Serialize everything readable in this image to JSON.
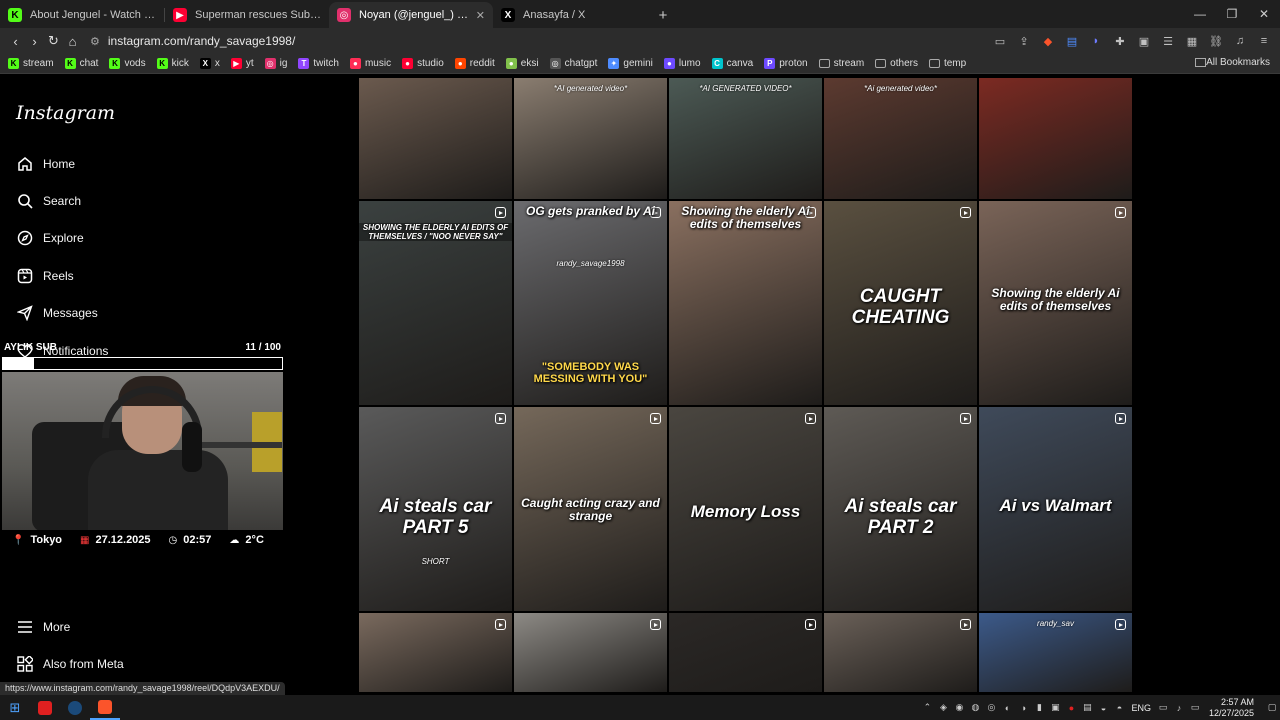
{
  "tabs": [
    {
      "title": "About Jenguel - Watch Live on Kick",
      "favicon": "K",
      "color": "#53fc18",
      "active": false
    },
    {
      "title": "Superman rescues Subarmine #shorts",
      "favicon": "▶",
      "color": "#ff0033",
      "active": false
    },
    {
      "title": "Noyan (@jenguel_) • Instagram",
      "favicon": "◎",
      "color": "#e1306c",
      "active": true
    },
    {
      "title": "Anasayfa / X",
      "favicon": "X",
      "color": "#000000",
      "active": false
    }
  ],
  "url": "instagram.com/randy_savage1998/",
  "bookmarks": [
    {
      "label": "stream",
      "icon": "K",
      "color": "#53fc18"
    },
    {
      "label": "chat",
      "icon": "K",
      "color": "#53fc18"
    },
    {
      "label": "vods",
      "icon": "K",
      "color": "#53fc18"
    },
    {
      "label": "kick",
      "icon": "K",
      "color": "#53fc18"
    },
    {
      "label": "x",
      "icon": "X",
      "color": "#000000"
    },
    {
      "label": "yt",
      "icon": "▶",
      "color": "#ff0033"
    },
    {
      "label": "ig",
      "icon": "◎",
      "color": "#e1306c"
    },
    {
      "label": "twitch",
      "icon": "T",
      "color": "#9146ff"
    },
    {
      "label": "music",
      "icon": "●",
      "color": "#ff2d55"
    },
    {
      "label": "studio",
      "icon": "●",
      "color": "#ff0033"
    },
    {
      "label": "reddit",
      "icon": "●",
      "color": "#ff4500"
    },
    {
      "label": "eksi",
      "icon": "●",
      "color": "#81c14b"
    },
    {
      "label": "chatgpt",
      "icon": "◎",
      "color": "#555555"
    },
    {
      "label": "gemini",
      "icon": "✦",
      "color": "#4e8cff"
    },
    {
      "label": "lumo",
      "icon": "●",
      "color": "#6d4aff"
    },
    {
      "label": "canva",
      "icon": "C",
      "color": "#00c4cc"
    },
    {
      "label": "proton",
      "icon": "P",
      "color": "#6d4aff"
    },
    {
      "label": "stream",
      "icon": "▭",
      "color": "#2c2c2c"
    },
    {
      "label": "others",
      "icon": "▭",
      "color": "#2c2c2c"
    },
    {
      "label": "temp",
      "icon": "▭",
      "color": "#2c2c2c"
    }
  ],
  "all_bookmarks": "All Bookmarks",
  "instagram": {
    "logo": "Instagram",
    "nav": [
      {
        "label": "Home",
        "icon": "home-icon"
      },
      {
        "label": "Search",
        "icon": "search-icon"
      },
      {
        "label": "Explore",
        "icon": "compass-icon"
      },
      {
        "label": "Reels",
        "icon": "reels-icon"
      },
      {
        "label": "Messages",
        "icon": "messages-icon"
      },
      {
        "label": "Notifications",
        "icon": "heart-icon"
      }
    ],
    "more": "More",
    "also_from_meta": "Also from Meta"
  },
  "overlay": {
    "sub_label": "AYLIK SUB",
    "sub_count": "11 / 100",
    "progress": 0.11,
    "location": "Tokyo",
    "date": "27.12.2025",
    "time": "02:57",
    "weather": "2°C"
  },
  "posts": [
    {
      "caption": "",
      "small": "",
      "reel": false,
      "bg": "#6b5a4e"
    },
    {
      "caption": "",
      "small": "*AI generated video*",
      "reel": false,
      "bg": "#8a7d70"
    },
    {
      "caption": "",
      "small": "*AI GENERATED VIDEO*",
      "reel": false,
      "bg": "#4c5a55"
    },
    {
      "caption": "",
      "small": "*Ai generated video*",
      "reel": false,
      "bg": "#5c3a30"
    },
    {
      "caption": "",
      "small": "",
      "reel": false,
      "bg": "#7c2a22"
    },
    {
      "caption": "",
      "small": "SHOWING THE ELDERLY AI EDITS OF THEMSELVES / \"NOO NEVER SAY\"",
      "reel": true,
      "bg": "#3b4140"
    },
    {
      "caption": "OG gets pranked by Ai / \"SOMEBODY WAS MESSING WITH YOU\"",
      "small": "randy_savage1998",
      "reel": true,
      "bg": "#6b6b6e"
    },
    {
      "caption": "Showing the elderly Ai edits of themselves",
      "small": "",
      "reel": true,
      "bg": "#8a7060"
    },
    {
      "caption": "CAUGHT CHEATING",
      "small": "",
      "reel": true,
      "bg": "#5a5040"
    },
    {
      "caption": "Showing the elderly Ai edits of themselves",
      "small": "",
      "reel": true,
      "bg": "#7a6458"
    },
    {
      "caption": "Ai steals car PART 5",
      "small": "SHORT",
      "reel": true,
      "bg": "#5a5a5a"
    },
    {
      "caption": "Caught acting crazy and strange",
      "small": "",
      "reel": true,
      "bg": "#75685a"
    },
    {
      "caption": "Memory Loss",
      "small": "",
      "reel": true,
      "bg": "#4a4640"
    },
    {
      "caption": "Ai steals car PART 2",
      "small": "",
      "reel": true,
      "bg": "#5e5a55"
    },
    {
      "caption": "Ai vs Walmart",
      "small": "",
      "reel": true,
      "bg": "#3f4a5a"
    },
    {
      "caption": "",
      "small": "",
      "reel": true,
      "bg": "#7a6a5e"
    },
    {
      "caption": "",
      "small": "",
      "reel": true,
      "bg": "#8d8a85"
    },
    {
      "caption": "",
      "small": "",
      "reel": true,
      "bg": "#2b2826"
    },
    {
      "caption": "",
      "small": "",
      "reel": true,
      "bg": "#6a6058"
    },
    {
      "caption": "",
      "small": "randy_sav",
      "reel": true,
      "bg": "#3c5a8a"
    }
  ],
  "status_url": "https://www.instagram.com/randy_savage1998/reel/DQdpV3AEXDU/",
  "taskbar": {
    "language": "ENG",
    "time": "2:57 AM",
    "date": "12/27/2025"
  }
}
